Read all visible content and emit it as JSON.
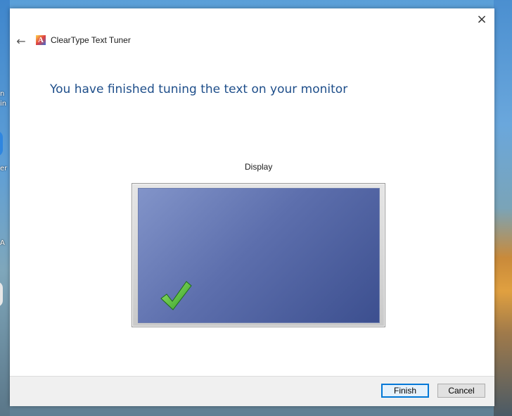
{
  "window": {
    "title": "ClearType Text Tuner",
    "close_icon": "×",
    "back_icon": "←",
    "app_icon_glyph": "A"
  },
  "content": {
    "heading": "You have finished tuning the text on your monitor",
    "display_label": "Display"
  },
  "footer": {
    "finish_label": "Finish",
    "cancel_label": "Cancel"
  },
  "desktop": {
    "fragments": [
      "n",
      "in",
      "er",
      "A"
    ]
  },
  "colors": {
    "heading": "#1e4e8a",
    "screen_gradient_start": "#8294c9",
    "screen_gradient_end": "#3c4f8f",
    "check_green": "#46c13a",
    "primary_button_border": "#0078d7"
  },
  "icons": {
    "close": "close-icon",
    "back": "back-arrow-icon",
    "app": "cleartype-app-icon",
    "check": "checkmark-icon"
  }
}
